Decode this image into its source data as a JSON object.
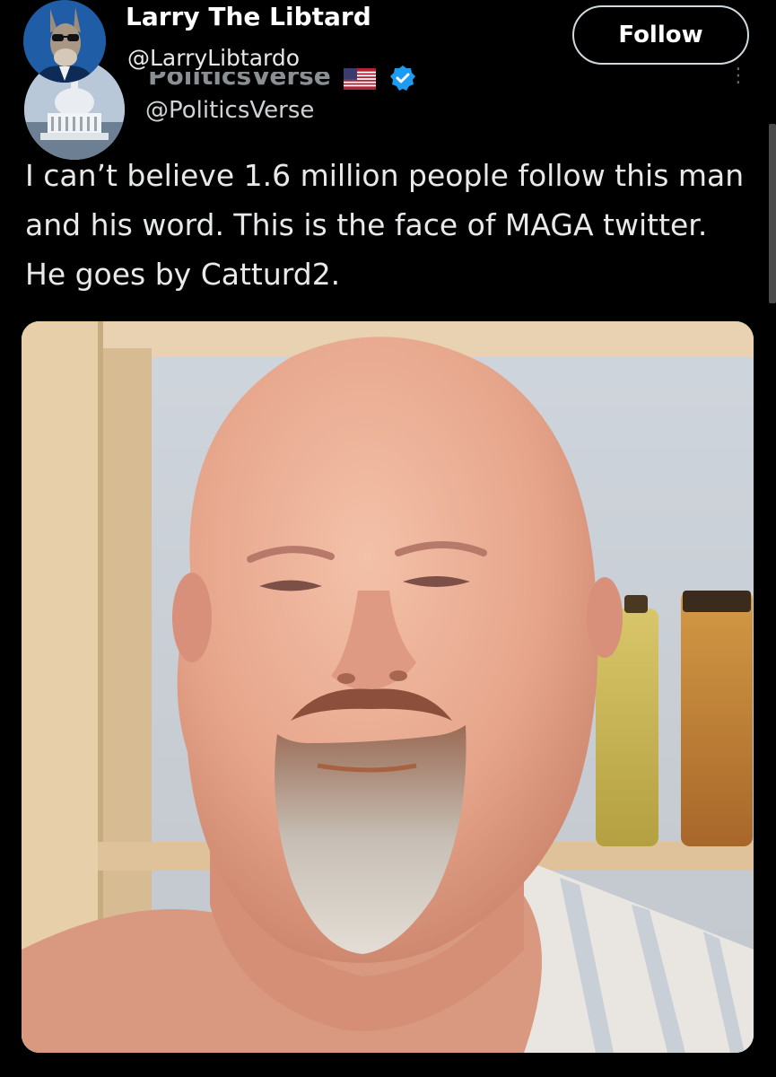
{
  "outer_post": {
    "display_name": "Larry The Libtard",
    "handle": "@LarryLibtardo",
    "follow_label": "Follow",
    "avatar_icon": "donkey-avatar-icon"
  },
  "quoted_post": {
    "display_name": "PoliticsVerse",
    "handle": "@PoliticsVerse",
    "flag_icon": "us-flag-icon",
    "verified_icon": "verified-badge-icon",
    "more_icon": "more-options-icon",
    "text": "I can’t believe 1.6 million people follow this man and his word. This is the face of MAGA twitter. He goes by Catturd2.",
    "media": "photo-of-bald-man-with-goatee"
  },
  "colors": {
    "background": "#000000",
    "text": "#e7e9ea",
    "verified": "#1d9bf0",
    "follow_border": "#cfd9de"
  }
}
